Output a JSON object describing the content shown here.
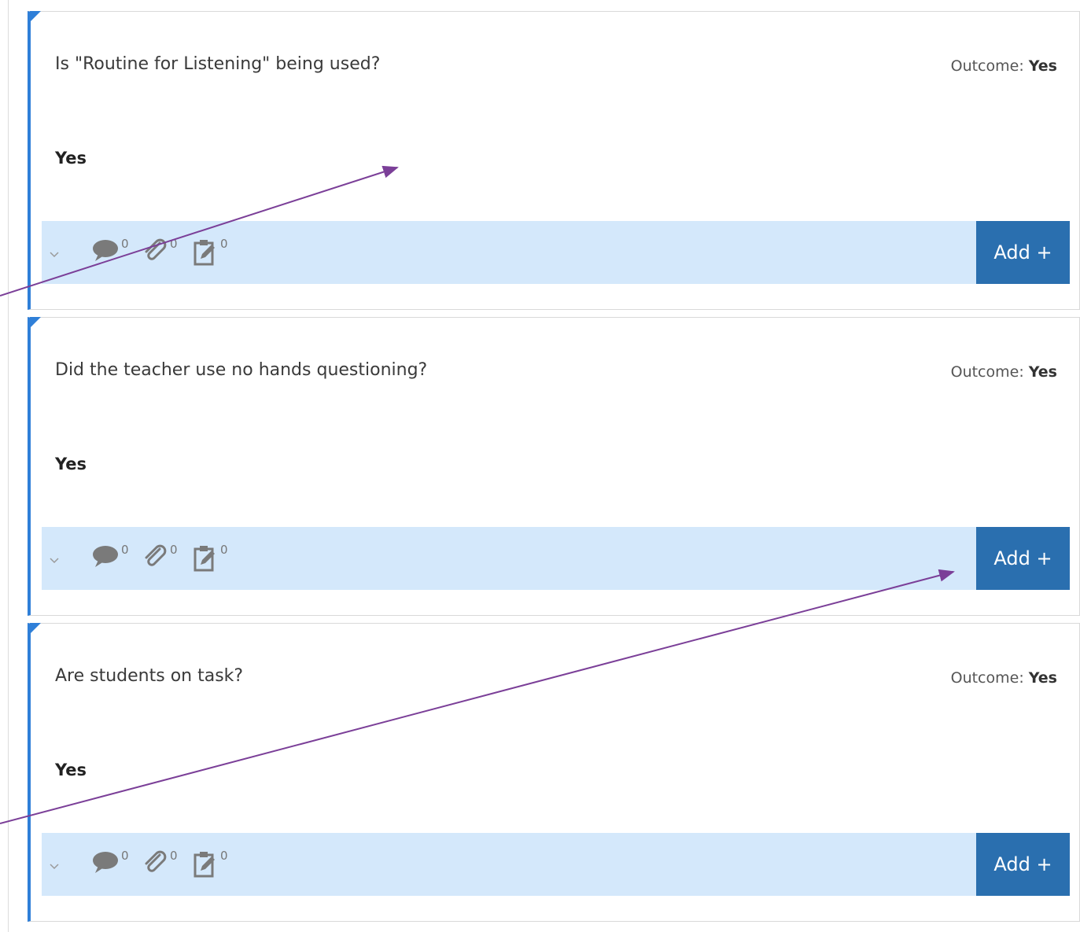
{
  "outcome_label": "Outcome:",
  "questions": [
    {
      "question": "Is \"Routine for Listening\" being used?",
      "outcome": "Yes",
      "answer": "Yes",
      "comments": "0",
      "attachments": "0",
      "notes": "0",
      "add_label": "Add +"
    },
    {
      "question": "Did the teacher use no hands questioning?",
      "outcome": "Yes",
      "answer": "Yes",
      "comments": "0",
      "attachments": "0",
      "notes": "0",
      "add_label": "Add +"
    },
    {
      "question": "Are students on task?",
      "outcome": "Yes",
      "answer": "Yes",
      "comments": "0",
      "attachments": "0",
      "notes": "0",
      "add_label": "Add +"
    }
  ],
  "icons": {
    "expand": "chevron-down-icon",
    "comments": "speech-bubble-icon",
    "attachments": "paperclip-icon",
    "notes": "clipboard-edit-icon"
  },
  "colors": {
    "accent": "#2f7fd8",
    "toolbar_bg": "#d4e8fb",
    "button_bg": "#2a6faf",
    "annotation_arrow": "#7b3f98"
  }
}
